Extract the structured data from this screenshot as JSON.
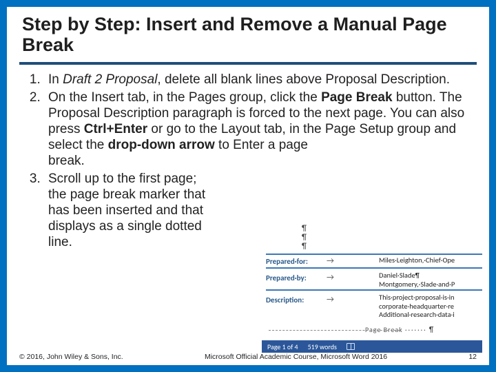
{
  "title": "Step by Step: Insert and Remove a Manual Page Break",
  "steps": {
    "s1": {
      "pre": "In ",
      "doc": "Draft 2 Proposal",
      "post": ", delete all blank lines above Proposal Description."
    },
    "s2": {
      "a": "On the Insert tab, in the Pages group, click the ",
      "b1": "Page Break",
      "c": " button. The Proposal Description paragraph is forced to the next page. You can also press ",
      "b2": "Ctrl+Enter",
      "d": " or go to the Layout tab, in the Page Setup group and select the ",
      "b3": "drop-down arrow",
      "e": " to Enter a page",
      "f": "break."
    },
    "s3": {
      "a": "Scroll up to the first page;",
      "b": "the page break marker that",
      "c": "has been inserted and that",
      "d": "displays as a single dotted",
      "e": "line."
    }
  },
  "embed": {
    "pilcrow": "¶",
    "prepared_for_label": "Prepared·for:",
    "prepared_for_value": "Miles·Leighton,·Chief·Ope",
    "prepared_by_label": "Prepared·by:",
    "prepared_by_value1": "Daniel·Slade¶",
    "prepared_by_value2": "Montgomery,·Slade·and·P",
    "description_label": "Description:",
    "description_value1": "This·project·proposal·is·in",
    "description_value2": "corporate·headquarter·re",
    "description_value3": "Additional·research·data·i",
    "arrow": "→",
    "page_break": "Page Break",
    "status_page": "Page 1 of 4",
    "status_words": "519 words"
  },
  "footer": {
    "copyright": "© 2016, John Wiley & Sons, Inc.",
    "course": "Microsoft Official Academic Course, Microsoft Word 2016",
    "page": "12"
  }
}
